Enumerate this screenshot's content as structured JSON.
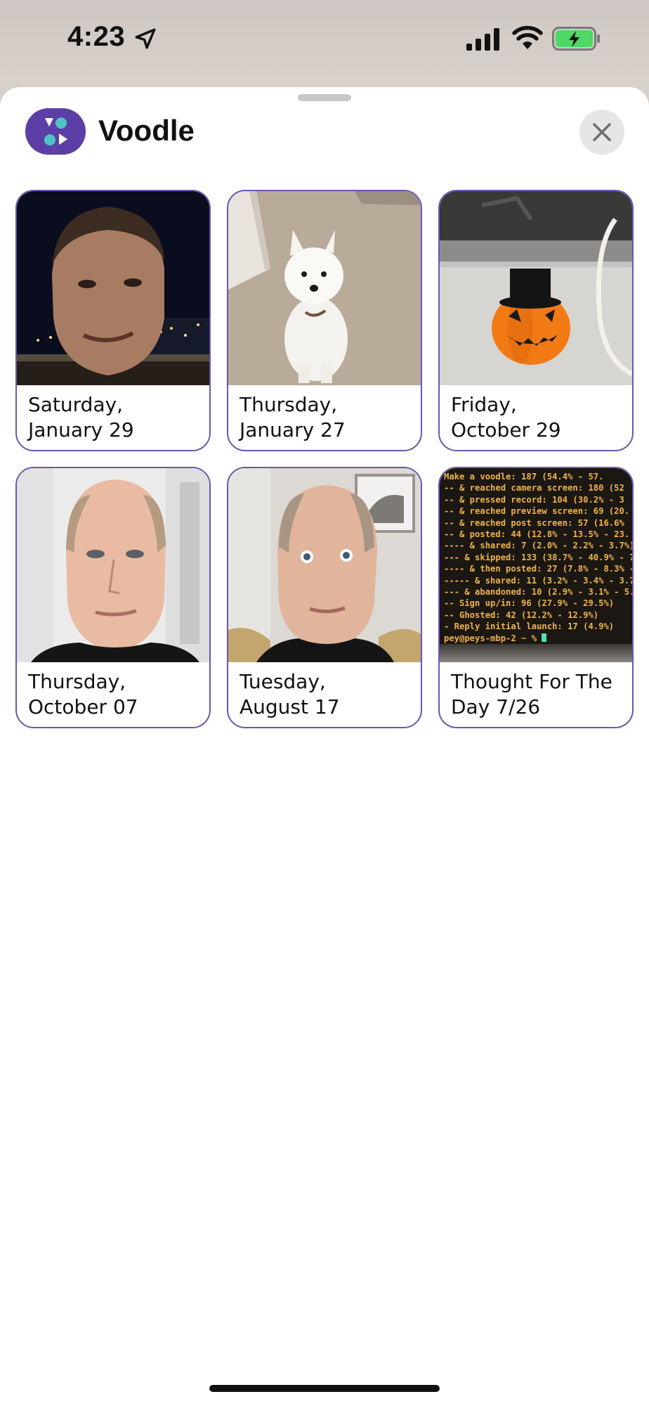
{
  "status_bar": {
    "time": "4:23",
    "icons": [
      "location-arrow-icon",
      "cellular-signal-icon",
      "wifi-icon",
      "battery-charging-icon"
    ],
    "battery_color": "#4cd964"
  },
  "sheet": {
    "app_name": "Voodle",
    "close_icon": "close-icon",
    "brand_color": "#5b3fa6",
    "accent_color": "#4fc3c3"
  },
  "voodles": [
    {
      "caption": "Saturday,\nJanuary 29",
      "thumbnail": "man-night-city-photo"
    },
    {
      "caption": "Thursday,\nJanuary 27",
      "thumbnail": "white-terrier-dog-photo"
    },
    {
      "caption": "Friday,\nOctober 29",
      "thumbnail": "jack-o-lantern-top-hat-photo"
    },
    {
      "caption": "Thursday,\nOctober 07",
      "thumbnail": "man-portrait-closet-photo"
    },
    {
      "caption": "Tuesday,\nAugust 17",
      "thumbnail": "man-portrait-room-photo"
    },
    {
      "caption": "Thought For The\nDay 7/26",
      "thumbnail": "terminal-screen-photo"
    }
  ],
  "terminal_lines": [
    "Make a voodle: 187 (54.4% - 57.",
    "-- & reached camera screen: 180 (52",
    "-- & pressed record: 104 (30.2% - 3",
    "-- & reached preview screen: 69 (20.",
    "-- & reached post screen: 57 (16.6%",
    "-- & posted: 44 (12.8% - 13.5% - 23.",
    "---- & shared: 7 (2.0% - 2.2% - 3.7%)",
    "--- & skipped: 133 (38.7% - 40.9% - 7",
    "---- & then posted: 27 (7.8% - 8.3% -",
    "----- & shared: 11 (3.2% - 3.4% - 3.7",
    "--- & abandoned: 10 (2.9% - 3.1% - 5.",
    "-- Sign up/in: 96 (27.9% - 29.5%)",
    "-- Ghosted: 42 (12.2% - 12.9%)",
    "- Reply initial launch: 17 (4.9%)",
    "pey@peys-mbp-2 ~ % "
  ]
}
